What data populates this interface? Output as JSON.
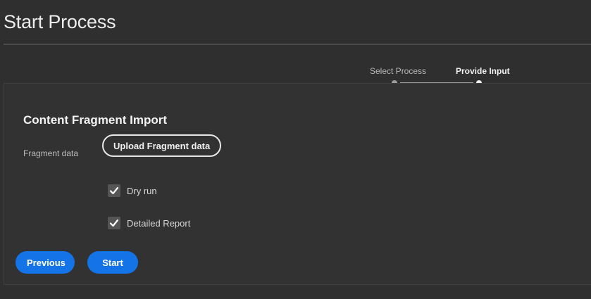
{
  "page": {
    "title": "Start Process"
  },
  "stepper": {
    "steps": [
      {
        "label": "Select Process",
        "state": "done"
      },
      {
        "label": "Provide Input",
        "state": "active"
      }
    ]
  },
  "form": {
    "section_title": "Content Fragment Import",
    "fragment_label": "Fragment data",
    "upload_button": "Upload Fragment data",
    "checkboxes": [
      {
        "label": "Dry run",
        "checked": true
      },
      {
        "label": "Detailed Report",
        "checked": true
      }
    ]
  },
  "actions": {
    "previous_label": "Previous",
    "start_label": "Start"
  },
  "colors": {
    "background": "#2f2f2f",
    "accent": "#1473e6",
    "checkbox": "#555555"
  },
  "icons": {
    "checkmark": "checkmark-icon"
  }
}
